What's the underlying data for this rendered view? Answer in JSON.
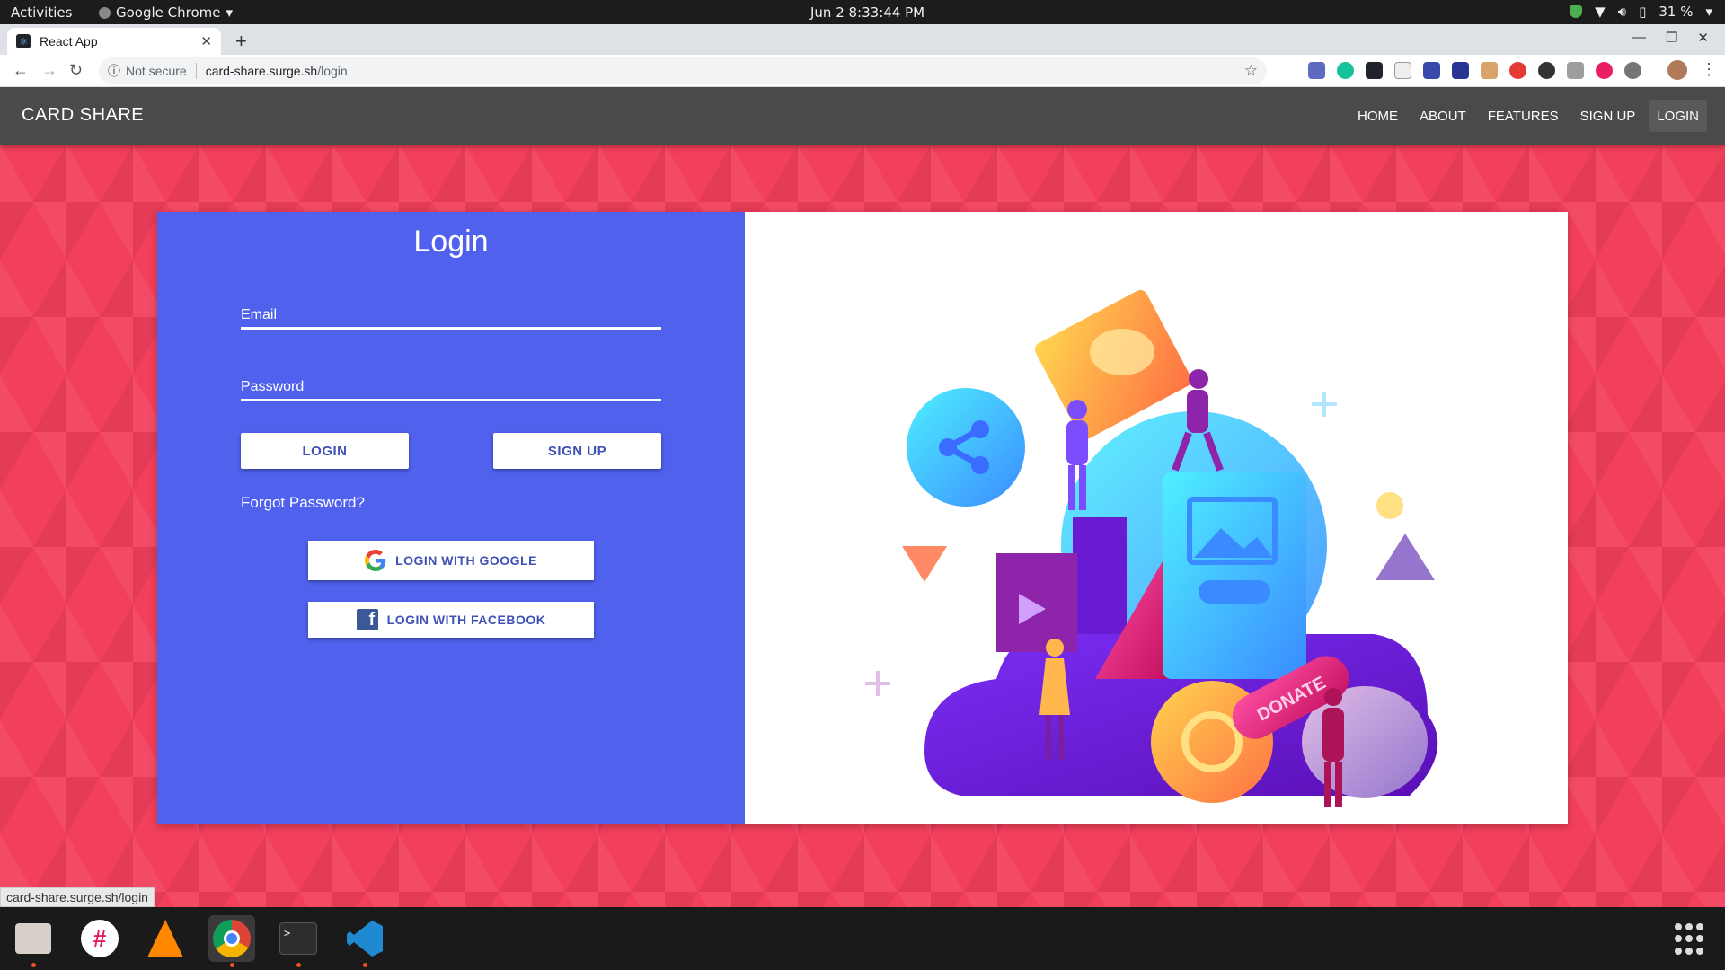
{
  "system": {
    "activities": "Activities",
    "app_menu": "Google Chrome",
    "clock": "Jun 2   8:33:44 PM",
    "battery": "31 %"
  },
  "browser": {
    "tab_title": "React App",
    "url_security": "Not secure",
    "url_host": "card-share.surge.sh",
    "url_path": "/login",
    "status_url": "card-share.surge.sh/login"
  },
  "appbar": {
    "brand": "CARD SHARE",
    "nav": [
      "HOME",
      "ABOUT",
      "FEATURES",
      "SIGN UP",
      "LOGIN"
    ],
    "active": "LOGIN"
  },
  "login": {
    "title": "Login",
    "email_label": "Email",
    "password_label": "Password",
    "login_button": "LOGIN",
    "signup_button": "SIGN UP",
    "forgot": "Forgot Password?",
    "google_button": "LOGIN WITH GOOGLE",
    "facebook_button": "LOGIN WITH FACEBOOK"
  },
  "illustration": {
    "sign_text": "DONATE"
  },
  "colors": {
    "panel": "#5061ee",
    "button_text": "#3f51b5",
    "background": "#f23f5b",
    "appbar": "#4a4a4a"
  }
}
